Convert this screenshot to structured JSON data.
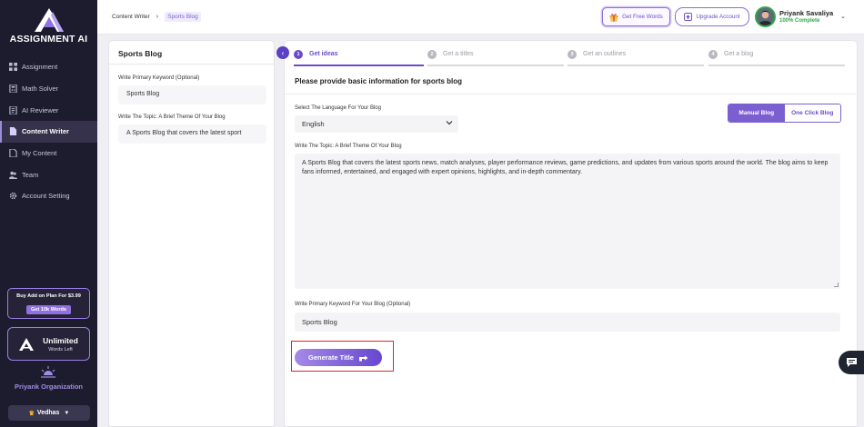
{
  "app": {
    "logo_text": "ASSIGNMENT AI"
  },
  "sidebar": {
    "items": [
      {
        "label": "Assignment",
        "icon": "grid-icon",
        "active": false
      },
      {
        "label": "Math Solver",
        "icon": "calculator-icon",
        "active": false
      },
      {
        "label": "AI Reviewer",
        "icon": "review-icon",
        "active": false
      },
      {
        "label": "Content Writer",
        "icon": "document-icon",
        "active": true
      },
      {
        "label": "My Content",
        "icon": "file-icon",
        "active": false
      },
      {
        "label": "Team",
        "icon": "team-icon",
        "active": false
      },
      {
        "label": "Account Setting",
        "icon": "gear-icon",
        "active": false
      }
    ],
    "addon": {
      "title": "Buy Add on Plan For $3.99",
      "button": "Get 10k Words"
    },
    "words": {
      "value": "Unlimited",
      "sub": "Words Left"
    },
    "org": {
      "name": "Priyank Organization",
      "workspace": "Vedhas"
    }
  },
  "header": {
    "breadcrumb": [
      "Content Writer",
      "Sports Blog"
    ],
    "free_words_label": "Get Free Words",
    "upgrade_label": "Upgrade Account",
    "user": {
      "name": "Priyank Savaliya",
      "status": "100% Complete"
    }
  },
  "left_panel": {
    "title": "Sports Blog",
    "keyword_label": "Write Primary Keyword (Optional)",
    "keyword_value": "Sports Blog",
    "topic_label": "Write The Topic: A Brief Theme Of Your Blog",
    "topic_value": "A Sports Blog that covers the latest sport"
  },
  "steps": [
    {
      "num": "1",
      "label": "Get ideas",
      "active": true
    },
    {
      "num": "2",
      "label": "Get a titles",
      "active": false
    },
    {
      "num": "3",
      "label": "Get an outlines",
      "active": false
    },
    {
      "num": "4",
      "label": "Get a blog",
      "active": false
    }
  ],
  "main": {
    "title": "Please provide basic information for sports blog",
    "language_label": "Select The Language For Your Blog",
    "language_value": "English",
    "mode_options": [
      "Manual Blog",
      "One Click Blog"
    ],
    "mode_selected": "Manual Blog",
    "topic_label": "Write The Topic: A Brief Theme Of Your Blog",
    "topic_value": "A Sports Blog that covers the latest sports news, match analyses, player performance reviews, game predictions, and updates from various sports around the world. The blog aims to keep fans informed, entertained, and engaged with expert opinions, highlights, and in-depth commentary.",
    "keyword_label": "Write Primary Keyword For Your Blog (Optional)",
    "keyword_value": "Sports Blog",
    "generate_label": "Generate Title"
  },
  "colors": {
    "accent": "#6b4bcc",
    "sidebar_bg": "#1d1b2e",
    "success": "#2faa4a",
    "highlight": "#e0262a"
  }
}
